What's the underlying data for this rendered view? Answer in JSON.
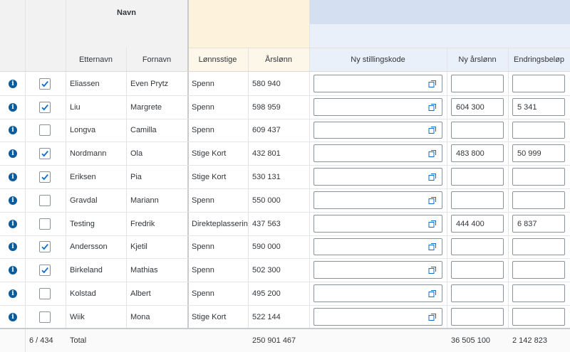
{
  "header": {
    "group_navn": "Navn",
    "columns": {
      "etternavn": "Etternavn",
      "fornavn": "Fornavn",
      "lonnsstige": "Lønnsstige",
      "arslonn": "Årslønn",
      "ny_stillingskode": "Ny stillingskode",
      "ny_arslonn": "Ny årslønn",
      "endringsbelop": "Endringsbeløp"
    }
  },
  "rows": [
    {
      "checked": true,
      "etternavn": "Eliassen",
      "fornavn": "Even Prytz",
      "lonnsstige": "Spenn",
      "arslonn": "580 940",
      "ny_stillingskode": "",
      "ny_arslonn": "",
      "endringsbelop": ""
    },
    {
      "checked": true,
      "etternavn": "Liu",
      "fornavn": "Margrete",
      "lonnsstige": "Spenn",
      "arslonn": "598 959",
      "ny_stillingskode": "",
      "ny_arslonn": "604 300",
      "endringsbelop": "5 341"
    },
    {
      "checked": false,
      "etternavn": "Longva",
      "fornavn": "Camilla",
      "lonnsstige": "Spenn",
      "arslonn": "609 437",
      "ny_stillingskode": "",
      "ny_arslonn": "",
      "endringsbelop": ""
    },
    {
      "checked": true,
      "etternavn": "Nordmann",
      "fornavn": "Ola",
      "lonnsstige": "Stige Kort",
      "arslonn": "432 801",
      "ny_stillingskode": "",
      "ny_arslonn": "483 800",
      "endringsbelop": "50 999"
    },
    {
      "checked": true,
      "etternavn": "Eriksen",
      "fornavn": "Pia",
      "lonnsstige": "Stige Kort",
      "arslonn": "530 131",
      "ny_stillingskode": "",
      "ny_arslonn": "",
      "endringsbelop": ""
    },
    {
      "checked": false,
      "etternavn": "Gravdal",
      "fornavn": "Mariann",
      "lonnsstige": "Spenn",
      "arslonn": "550 000",
      "ny_stillingskode": "",
      "ny_arslonn": "",
      "endringsbelop": ""
    },
    {
      "checked": false,
      "etternavn": "Testing",
      "fornavn": "Fredrik",
      "lonnsstige": "Direkteplassering",
      "arslonn": "437 563",
      "ny_stillingskode": "",
      "ny_arslonn": "444 400",
      "endringsbelop": "6 837"
    },
    {
      "checked": true,
      "etternavn": "Andersson",
      "fornavn": "Kjetil",
      "lonnsstige": "Spenn",
      "arslonn": "590 000",
      "ny_stillingskode": "",
      "ny_arslonn": "",
      "endringsbelop": ""
    },
    {
      "checked": true,
      "etternavn": "Birkeland",
      "fornavn": "Mathias",
      "lonnsstige": "Spenn",
      "arslonn": "502 300",
      "ny_stillingskode": "",
      "ny_arslonn": "",
      "endringsbelop": ""
    },
    {
      "checked": false,
      "etternavn": "Kolstad",
      "fornavn": "Albert",
      "lonnsstige": "Spenn",
      "arslonn": "495 200",
      "ny_stillingskode": "",
      "ny_arslonn": "",
      "endringsbelop": ""
    },
    {
      "checked": false,
      "etternavn": "Wiik",
      "fornavn": "Mona",
      "lonnsstige": "Stige Kort",
      "arslonn": "522 144",
      "ny_stillingskode": "",
      "ny_arslonn": "",
      "endringsbelop": ""
    }
  ],
  "footer": {
    "count": "6 / 434",
    "label": "Total",
    "arslonn_total": "250 901 467",
    "ny_arslonn_total": "36 505 100",
    "endringsbelop_total": "2 142 823"
  },
  "icons": {
    "row_info": "info-icon",
    "value_help": "value-help-icon",
    "checkbox_check": "checkmark-icon"
  },
  "colors": {
    "info_icon": "#0a5c9c",
    "checkmark": "#0a6ed1",
    "header_gray": "#f2f2f2",
    "lonn_group": "#fdf3dd",
    "ny_group": "#d4dff2"
  }
}
